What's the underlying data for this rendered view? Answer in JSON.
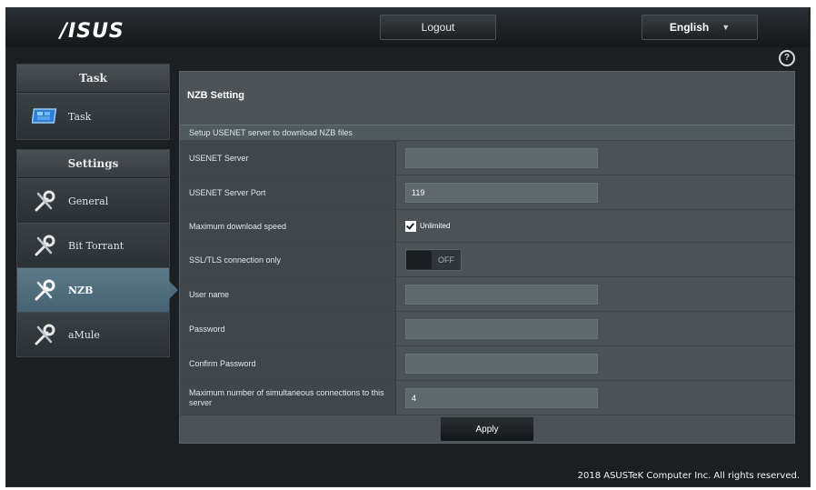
{
  "header": {
    "logo_text": "/ISUS",
    "logout_label": "Logout",
    "language_label": "English",
    "help_symbol": "?"
  },
  "sidebar": {
    "task": {
      "header": "Task",
      "items": [
        {
          "label": "Task",
          "icon": "monitor-icon"
        }
      ]
    },
    "settings": {
      "header": "Settings",
      "items": [
        {
          "label": "General",
          "icon": "wrench-screwdriver-icon"
        },
        {
          "label": "Bit Torrant",
          "icon": "wrench-screwdriver-icon"
        },
        {
          "label": "NZB",
          "icon": "wrench-screwdriver-icon",
          "active": true
        },
        {
          "label": "aMule",
          "icon": "wrench-screwdriver-icon"
        }
      ]
    }
  },
  "main": {
    "title": "NZB Setting",
    "subtitle": "Setup USENET server to download NZB files",
    "fields": [
      {
        "label": "USENET Server",
        "type": "input",
        "value": ""
      },
      {
        "label": "USENET Server Port",
        "type": "input",
        "value": "119"
      },
      {
        "label": "Maximum download speed",
        "type": "checkbox",
        "checkbox_label": "Unlimited",
        "checked": true
      },
      {
        "label": "SSL/TLS connection only",
        "type": "toggle",
        "toggle_text": "OFF"
      },
      {
        "label": "User name",
        "type": "input",
        "value": ""
      },
      {
        "label": "Password",
        "type": "input",
        "value": ""
      },
      {
        "label": "Confirm Password",
        "type": "input",
        "value": ""
      },
      {
        "label": "Maximum number of simultaneous connections to this server",
        "type": "input",
        "value": "4"
      }
    ],
    "apply_label": "Apply"
  },
  "footer": {
    "text": "2018 ASUSTeK Computer Inc. All rights reserved."
  }
}
